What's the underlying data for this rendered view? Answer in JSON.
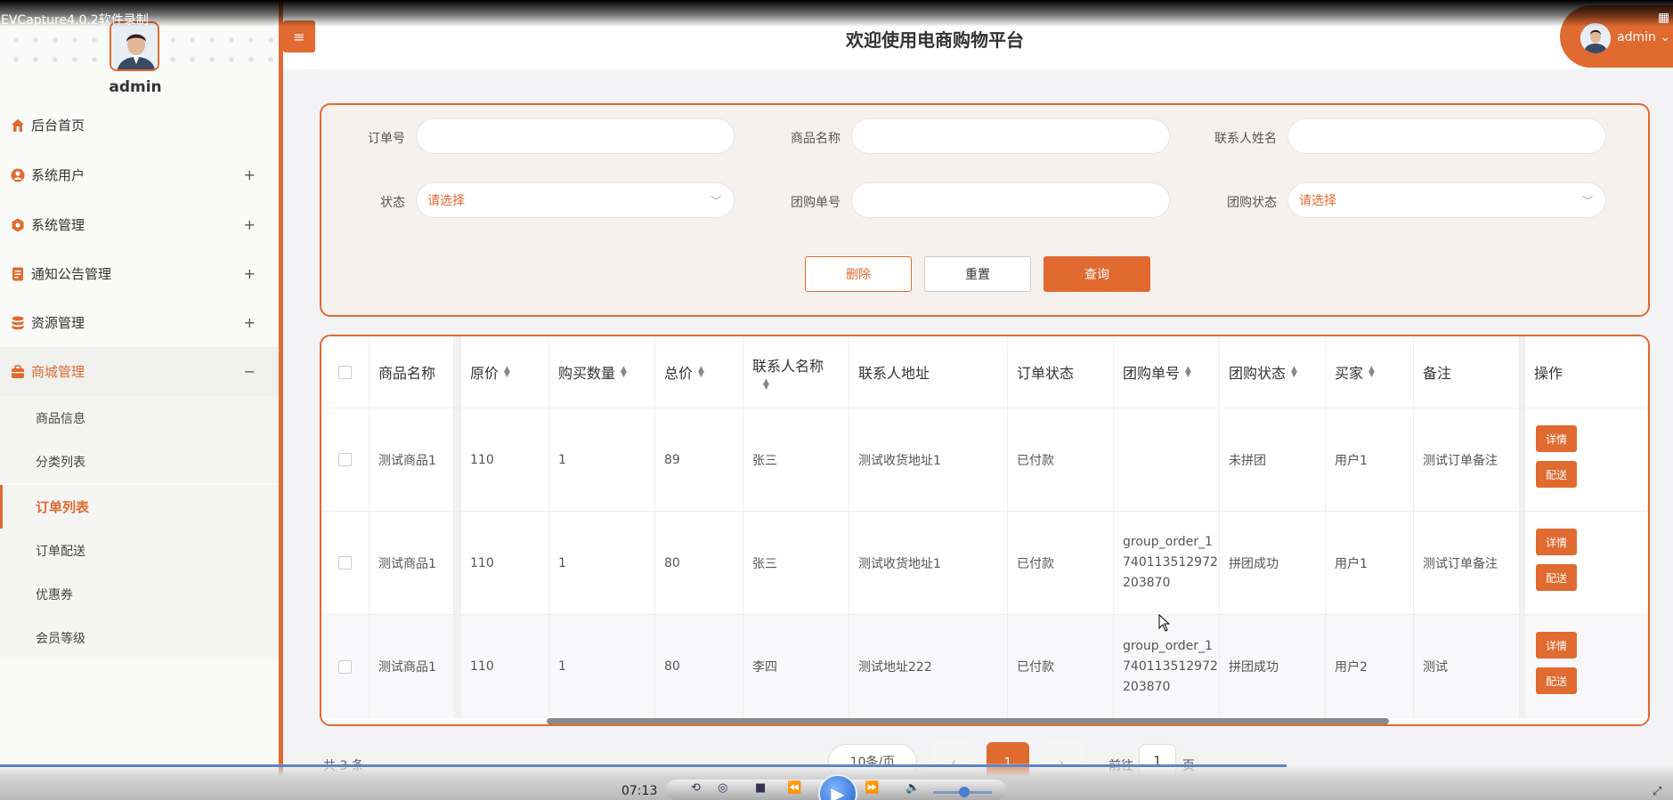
{
  "recorder": {
    "title": "EVCapture4.0.2软件录制"
  },
  "sidebar": {
    "username": "admin",
    "items": [
      {
        "label": "后台首页",
        "icon": "home-icon"
      },
      {
        "label": "系统用户",
        "icon": "user-icon",
        "toggle": "+"
      },
      {
        "label": "系统管理",
        "icon": "settings-icon",
        "toggle": "+"
      },
      {
        "label": "通知公告管理",
        "icon": "notice-icon",
        "toggle": "+"
      },
      {
        "label": "资源管理",
        "icon": "database-icon",
        "toggle": "+"
      },
      {
        "label": "商城管理",
        "icon": "shop-icon",
        "toggle": "−"
      }
    ],
    "subitems": [
      "商品信息",
      "分类列表",
      "订单列表",
      "订单配送",
      "优惠券",
      "会员等级"
    ]
  },
  "header": {
    "title": "欢迎使用电商购物平台",
    "user": "admin",
    "menu_icon": "≡"
  },
  "search": {
    "order_no_label": "订单号",
    "product_name_label": "商品名称",
    "contact_name_label": "联系人姓名",
    "status_label": "状态",
    "status_placeholder": "请选择",
    "group_order_label": "团购单号",
    "group_status_label": "团购状态",
    "group_status_placeholder": "请选择",
    "delete_label": "删除",
    "reset_label": "重置",
    "query_label": "查询"
  },
  "table": {
    "headers": [
      "商品名称",
      "原价",
      "购买数量",
      "总价",
      "联系人名称",
      "联系人地址",
      "订单状态",
      "团购单号",
      "团购状态",
      "买家",
      "备注",
      "操作"
    ],
    "rows": [
      {
        "product": "测试商品1",
        "price": "110",
        "qty": "1",
        "total": "89",
        "contact": "张三",
        "address": "测试收货地址1",
        "status": "已付款",
        "group_no": "",
        "group_status": "未拼团",
        "buyer": "用户1",
        "remark": "测试订单备注"
      },
      {
        "product": "测试商品1",
        "price": "110",
        "qty": "1",
        "total": "80",
        "contact": "张三",
        "address": "测试收货地址1",
        "status": "已付款",
        "group_no": "group_order_1740113512972203870",
        "group_status": "拼团成功",
        "buyer": "用户1",
        "remark": "测试订单备注"
      },
      {
        "product": "测试商品1",
        "price": "110",
        "qty": "1",
        "total": "80",
        "contact": "李四",
        "address": "测试地址222",
        "status": "已付款",
        "group_no": "group_order_1740113512972203870",
        "group_status": "拼团成功",
        "buyer": "用户2",
        "remark": "测试"
      }
    ],
    "group_no_lines": [
      "group_order_1",
      "740113512972",
      "203870"
    ],
    "detail_label": "详情",
    "deliver_label": "配送"
  },
  "pagination": {
    "total": "共 3 条",
    "page_size": "10条/页",
    "current": "1",
    "goto": "前往",
    "goto_value": "1",
    "unit": "页"
  },
  "player": {
    "time": "07:13"
  },
  "colors": {
    "accent": "#e06a30",
    "panel_bg": "#f7f1ee"
  }
}
